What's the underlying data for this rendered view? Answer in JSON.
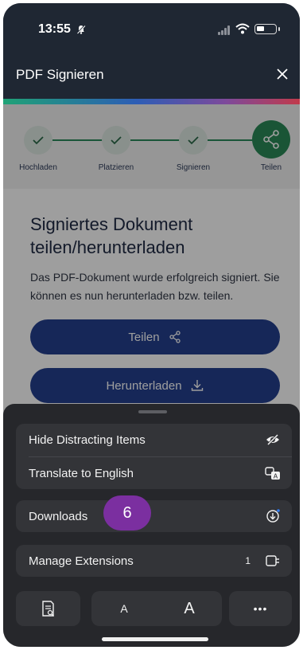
{
  "status_bar": {
    "time": "13:55"
  },
  "header": {
    "title": "PDF Signieren"
  },
  "stepper": {
    "steps": [
      {
        "label": "Hochladen"
      },
      {
        "label": "Platzieren"
      },
      {
        "label": "Signieren"
      },
      {
        "label": "Teilen"
      }
    ]
  },
  "content": {
    "heading": "Signiertes Dokument teilen/herunterladen",
    "description": "Das PDF-Dokument wurde erfolgreich signiert. Sie können es nun herunterladen bzw. teilen.",
    "share_label": "Teilen",
    "download_label": "Herunterladen"
  },
  "menu": {
    "hide_distracting": "Hide Distracting Items",
    "translate": "Translate to English",
    "downloads": "Downloads",
    "manage_extensions": "Manage Extensions",
    "extensions_count": "1",
    "step_badge": "6",
    "font_small": "A",
    "font_large": "A",
    "more": "•••"
  },
  "colors": {
    "brand_blue": "#25408e",
    "step_green": "#2b8a58",
    "badge_purple": "#7b2fa0",
    "sheet_bg": "#26272b"
  }
}
